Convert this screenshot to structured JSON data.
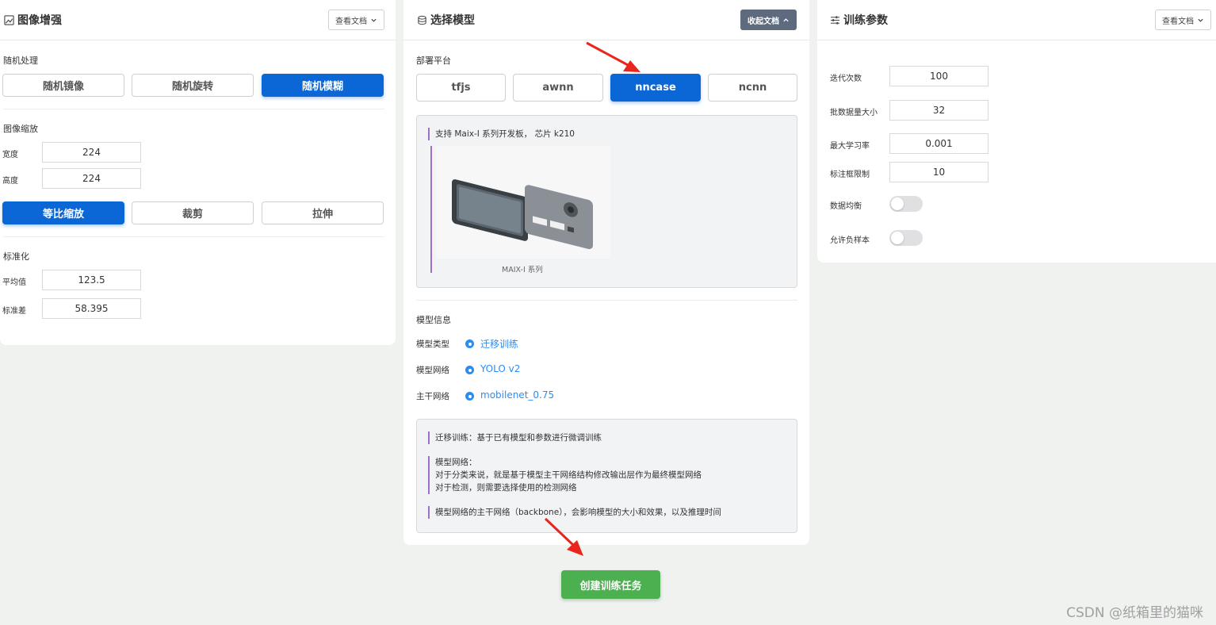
{
  "augment": {
    "title": "图像增强",
    "doc_btn": "查看文档",
    "random_section": "随机处理",
    "random_buttons": [
      "随机镜像",
      "随机旋转",
      "随机模糊"
    ],
    "scale_section": "图像缩放",
    "width_label": "宽度",
    "width_value": "224",
    "height_label": "高度",
    "height_value": "224",
    "scale_buttons": [
      "等比缩放",
      "裁剪",
      "拉伸"
    ],
    "norm_section": "标准化",
    "mean_label": "平均值",
    "mean_value": "123.5",
    "std_label": "标准差",
    "std_value": "58.395"
  },
  "model": {
    "title": "选择模型",
    "doc_btn": "收起文档",
    "platform_section": "部署平台",
    "platforms": [
      "tfjs",
      "awnn",
      "nncase",
      "ncnn"
    ],
    "platform_desc": "支持 Maix-I 系列开发板， 芯片 k210",
    "image_caption": "MAIX-I 系列",
    "info_section": "模型信息",
    "type_label": "模型类型",
    "type_value": "迁移训练",
    "net_label": "模型网络",
    "net_value": "YOLO v2",
    "backbone_label": "主干网络",
    "backbone_value": "mobilenet_0.75",
    "doc_lines": {
      "transfer": "迁移训练：基于已有模型和参数进行微调训练",
      "net_title": "模型网络：",
      "net_line1": "对于分类来说，就是基于模型主干网络结构修改输出层作为最终模型网络",
      "net_line2": "对于检测，则需要选择使用的检测网络",
      "backbone": "模型网络的主干网络（backbone），会影响模型的大小和效果，以及推理时间"
    }
  },
  "train": {
    "title": "训练参数",
    "doc_btn": "查看文档",
    "epochs_label": "迭代次数",
    "epochs_value": "100",
    "batch_label": "批数据量大小",
    "batch_value": "32",
    "lr_label": "最大学习率",
    "lr_value": "0.001",
    "bbox_label": "标注框限制",
    "bbox_value": "10",
    "balance_label": "数据均衡",
    "negative_label": "允许负样本"
  },
  "create_button": "创建训练任务",
  "watermark": "CSDN @纸箱里的猫咪",
  "colors": {
    "primary": "#0b66d6",
    "success": "#4caf50",
    "link": "#2d8cf0",
    "accent_arrow": "#e8261d"
  }
}
